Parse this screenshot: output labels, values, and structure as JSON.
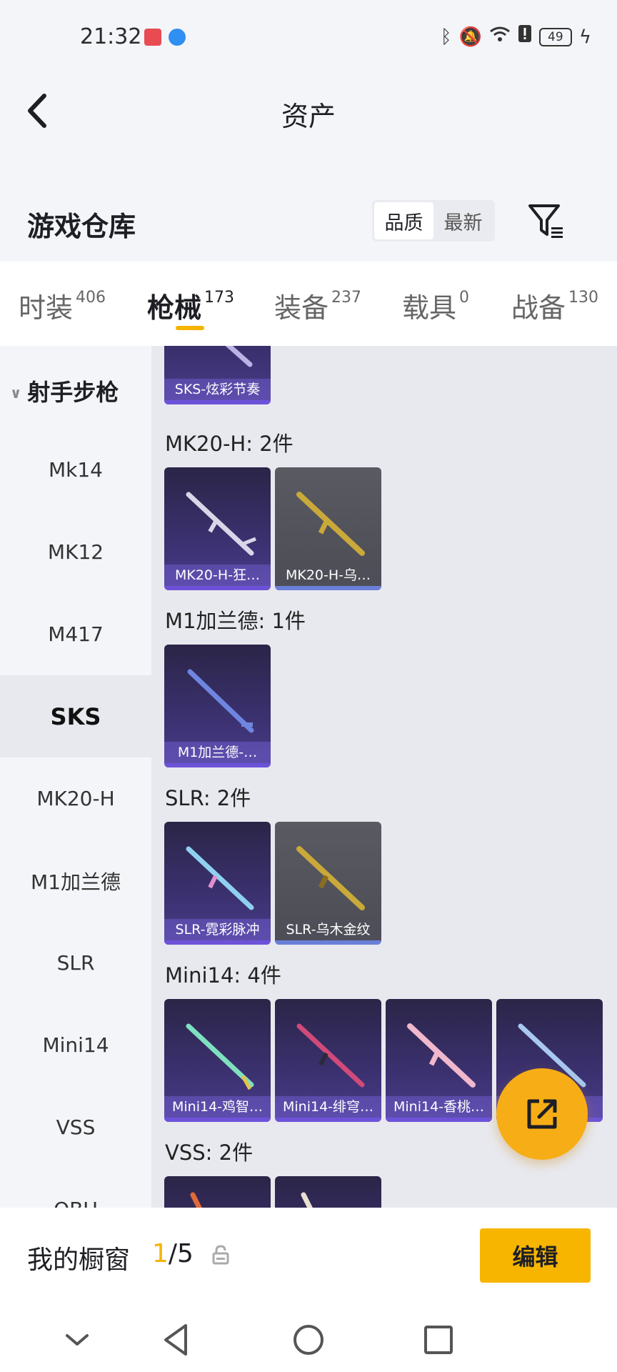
{
  "status_bar": {
    "time": "21:32",
    "battery": "49"
  },
  "header": {
    "title": "资产"
  },
  "warehouse": {
    "title": "游戏仓库",
    "sort_options": [
      "品质",
      "最新"
    ],
    "active_sort": "品质"
  },
  "tabs": [
    {
      "label": "时装",
      "count": "406"
    },
    {
      "label": "枪械",
      "count": "173"
    },
    {
      "label": "装备",
      "count": "237"
    },
    {
      "label": "载具",
      "count": "0"
    },
    {
      "label": "战备",
      "count": "130"
    }
  ],
  "active_tab": "枪械",
  "sidebar": {
    "group": "射手步枪",
    "items": [
      "Mk14",
      "MK12",
      "M417",
      "SKS",
      "MK20-H",
      "M1加兰德",
      "SLR",
      "Mini14",
      "VSS",
      "QBU"
    ],
    "active": "SKS"
  },
  "content": {
    "top_card": {
      "name": "SKS-炫彩节奏"
    },
    "sections": [
      {
        "title": "MK20-H: 2件",
        "items": [
          {
            "name": "MK20-H-狂…",
            "style": "purple"
          },
          {
            "name": "MK20-H-乌…",
            "style": "gold"
          }
        ]
      },
      {
        "title": "M1加兰德: 1件",
        "items": [
          {
            "name": "M1加兰德-…",
            "style": "purple"
          }
        ]
      },
      {
        "title": "SLR: 2件",
        "items": [
          {
            "name": "SLR-霓彩脉冲",
            "style": "purple"
          },
          {
            "name": "SLR-乌木金纹",
            "style": "gold"
          }
        ]
      },
      {
        "title": "Mini14: 4件",
        "items": [
          {
            "name": "Mini14-鸡智…",
            "style": "purple"
          },
          {
            "name": "Mini14-绯穹…",
            "style": "purple"
          },
          {
            "name": "Mini14-香桃…",
            "style": "purple"
          },
          {
            "name": "Mini14-…",
            "style": "purple"
          }
        ]
      },
      {
        "title": "VSS: 2件",
        "items": []
      }
    ]
  },
  "showcase": {
    "label": "我的橱窗",
    "current": "1",
    "total": "/5",
    "edit_label": "编辑"
  },
  "colors": {
    "accent": "#f7b500",
    "card_purple": "#3b3170",
    "card_gold": "#4c4c55"
  }
}
